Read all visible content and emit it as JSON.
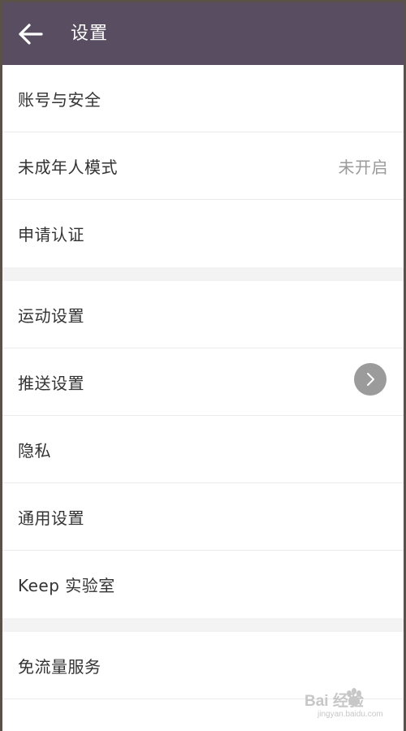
{
  "header": {
    "title": "设置"
  },
  "groups": [
    {
      "items": [
        {
          "label": "账号与安全",
          "value": ""
        },
        {
          "label": "未成年人模式",
          "value": "未开启"
        },
        {
          "label": "申请认证",
          "value": ""
        }
      ]
    },
    {
      "items": [
        {
          "label": "运动设置",
          "value": ""
        },
        {
          "label": "推送设置",
          "value": ""
        },
        {
          "label": "隐私",
          "value": ""
        },
        {
          "label": "通用设置",
          "value": ""
        },
        {
          "label": "Keep 实验室",
          "value": ""
        }
      ]
    },
    {
      "items": [
        {
          "label": "免流量服务",
          "value": ""
        }
      ]
    }
  ],
  "watermark": {
    "main": "Bai  经验",
    "sub": "jingyan.baidu.com"
  },
  "colors": {
    "topbar": "#594e61",
    "row_text": "#333333",
    "value_text": "#9a9a9a",
    "floating_button": "#9b9b9b"
  },
  "icons": {
    "back": "arrow-left-icon",
    "floating": "chevron-right-icon"
  }
}
